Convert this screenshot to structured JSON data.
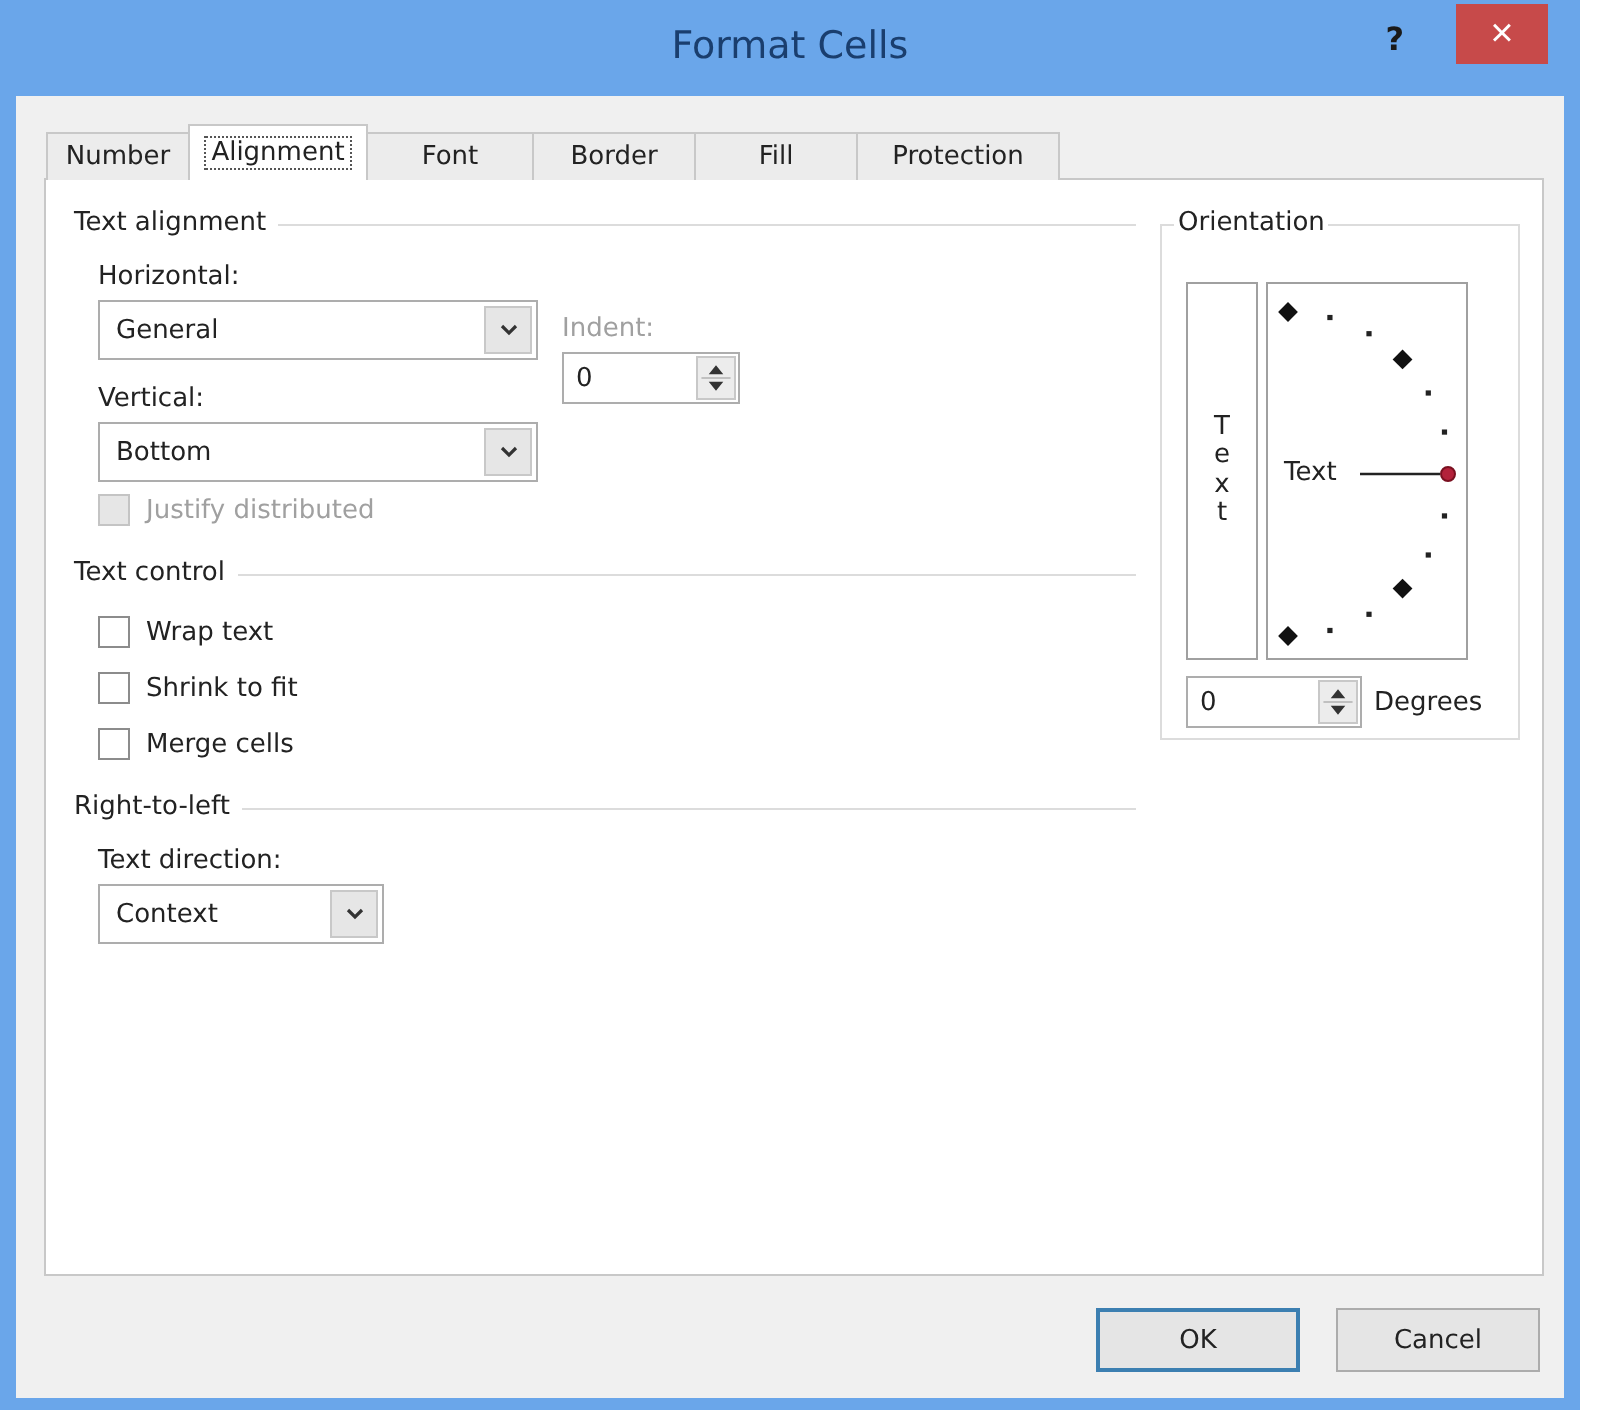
{
  "window": {
    "title": "Format Cells",
    "help": "?",
    "close": "×"
  },
  "tabs": [
    {
      "label": "Number",
      "selected": false
    },
    {
      "label": "Alignment",
      "selected": true
    },
    {
      "label": "Font",
      "selected": false
    },
    {
      "label": "Border",
      "selected": false
    },
    {
      "label": "Fill",
      "selected": false
    },
    {
      "label": "Protection",
      "selected": false
    }
  ],
  "text_alignment": {
    "title": "Text alignment",
    "horizontal": {
      "label": "Horizontal:",
      "value": "General"
    },
    "vertical": {
      "label": "Vertical:",
      "value": "Bottom"
    },
    "indent": {
      "label": "Indent:",
      "value": "0",
      "disabled": true
    },
    "justify_distributed": {
      "label": "Justify distributed",
      "checked": false,
      "disabled": true
    }
  },
  "text_control": {
    "title": "Text control",
    "options": [
      {
        "label": "Wrap text",
        "checked": false
      },
      {
        "label": "Shrink to fit",
        "checked": false
      },
      {
        "label": "Merge cells",
        "checked": false
      }
    ]
  },
  "right_to_left": {
    "title": "Right-to-left",
    "text_direction": {
      "label": "Text direction:",
      "value": "Context"
    }
  },
  "orientation": {
    "title": "Orientation",
    "vertical_text": "Text",
    "dial_label": "Text",
    "degrees": {
      "value": "0",
      "label": "Degrees"
    }
  },
  "buttons": [
    {
      "label": "OK",
      "default": true
    },
    {
      "label": "Cancel",
      "default": false
    }
  ]
}
